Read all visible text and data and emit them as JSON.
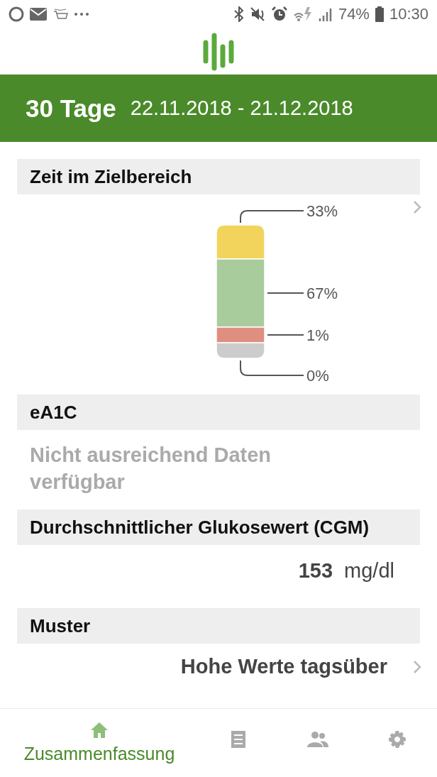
{
  "status_bar": {
    "battery": "74%",
    "time": "10:30"
  },
  "header": {
    "period": "30 Tage",
    "range": "22.11.2018 - 21.12.2018"
  },
  "time_in_range": {
    "title": "Zeit im Zielbereich",
    "segments": [
      {
        "label": "33%",
        "color": "#f2d45c"
      },
      {
        "label": "67%",
        "color": "#a8cc9c"
      },
      {
        "label": "1%",
        "color": "#de8f80"
      },
      {
        "label": "0%",
        "color": "#cccccc"
      }
    ]
  },
  "ea1c": {
    "title": "eA1C",
    "message": "Nicht ausreichend Daten verfügbar"
  },
  "average": {
    "title": "Durchschnittlicher Glukosewert (CGM)",
    "value": "153",
    "unit": "mg/dl"
  },
  "pattern": {
    "title": "Muster",
    "value": "Hohe Werte tagsüber"
  },
  "nav": [
    {
      "kind": "home",
      "label": "Zusammenfassung",
      "selected": true
    },
    {
      "kind": "report",
      "selected": false
    },
    {
      "kind": "people",
      "selected": false
    },
    {
      "kind": "settings",
      "selected": false
    }
  ]
}
